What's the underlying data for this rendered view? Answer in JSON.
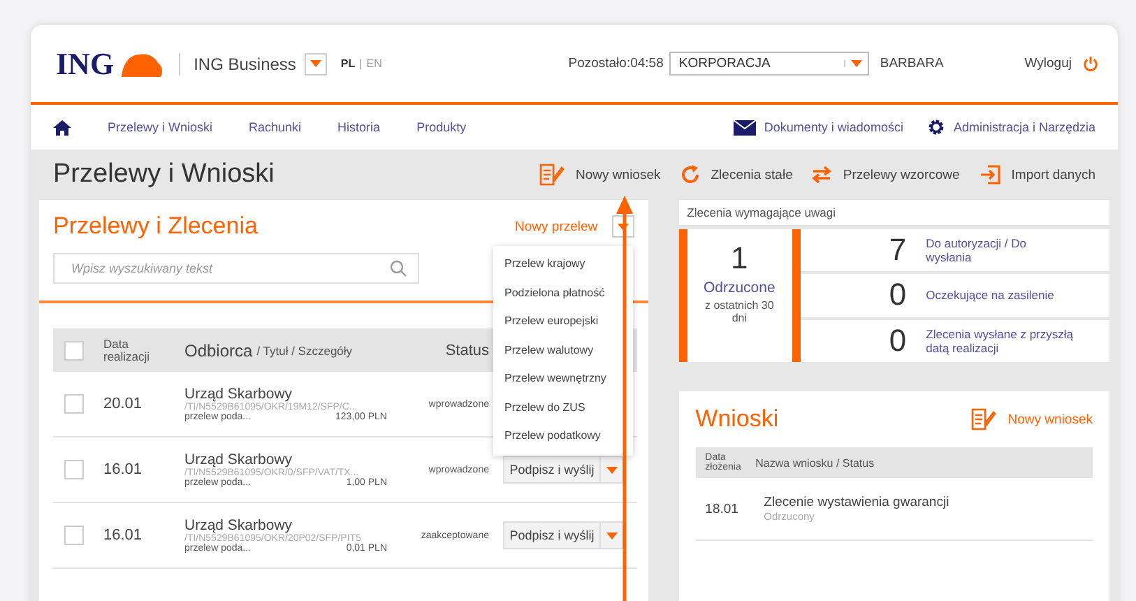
{
  "header": {
    "logo": "ING",
    "product": "ING Business",
    "languages": [
      {
        "label": "PL",
        "selected": true
      },
      {
        "label": "EN",
        "selected": false
      }
    ],
    "language_separator": "|",
    "session": "Pozostało:04:58",
    "company": "KORPORACJA",
    "user": "BARBARA",
    "logout": "Wyloguj"
  },
  "nav": {
    "items": [
      {
        "label": "Przelewy i Wnioski"
      },
      {
        "label": "Rachunki"
      },
      {
        "label": "Historia"
      },
      {
        "label": "Produkty"
      }
    ],
    "right": [
      {
        "label": "Dokumenty i wiadomości"
      },
      {
        "label": "Administracja i Narzędzia"
      }
    ]
  },
  "page": {
    "title": "Przelewy i Wnioski",
    "actions": [
      {
        "label": "Nowy wniosek"
      },
      {
        "label": "Zlecenia stałe"
      },
      {
        "label": "Przelewy wzorcowe"
      },
      {
        "label": "Import danych"
      }
    ]
  },
  "transfers": {
    "title": "Przelewy i Zlecenia",
    "new_button": "Nowy przelew",
    "search": {
      "placeholder": "Wpisz wyszukiwany tekst"
    },
    "all_checked": false,
    "columns": {
      "date": "Data realizacji",
      "recipient": "Odbiorca",
      "details": "/ Tytuł / Szczegóły",
      "status": "Status"
    },
    "rows": [
      {
        "checked": false,
        "date": "20.01",
        "recipient": "Urząd Skarbowy",
        "reference": "/TI/N5529B61095/OKR/19M12/SFP/C...",
        "title": "przelew poda...",
        "amount": "123,00 PLN",
        "status": "wprowadzone"
      },
      {
        "checked": false,
        "date": "16.01",
        "recipient": "Urząd Skarbowy",
        "reference": "/TI/N5529B61095/OKR/0/SFP/VAT/TX...",
        "title": "przelew poda...",
        "amount": "1,00 PLN",
        "status": "wprowadzone",
        "action": "Podpisz i wyślij"
      },
      {
        "checked": false,
        "date": "16.01",
        "recipient": "Urząd Skarbowy",
        "reference": "/TI/N5529B61095/OKR/20P02/SFP/PIT5",
        "title": "przelew poda...",
        "amount": "0,01 PLN",
        "status": "zaakceptowane",
        "action": "Podpisz i wyślij"
      }
    ],
    "menu": [
      "Przelew krajowy",
      "Podzielona płatność",
      "Przelew europejski",
      "Przelew walutowy",
      "Przelew wewnętrzny",
      "Przelew do ZUS",
      "Przelew podatkowy"
    ]
  },
  "attention": {
    "title": "Zlecenia wymagające uwagi",
    "rejected": {
      "count": "1",
      "label": "Odrzucone",
      "note": "z ostatnich 30 dni"
    },
    "items": [
      {
        "count": "7",
        "label": "Do autoryzacji / Do wysłania"
      },
      {
        "count": "0",
        "label": "Oczekujące na zasilenie"
      },
      {
        "count": "0",
        "label": "Zlecenia wysłane z przyszłą datą realizacji"
      }
    ]
  },
  "applications": {
    "title": "Wnioski",
    "new_button": "Nowy wniosek",
    "columns": {
      "date": "Data złożenia",
      "name": "Nazwa wniosku / Status"
    },
    "rows": [
      {
        "date": "18.01",
        "name": "Zlecenie wystawienia gwarancji",
        "status": "Odrzucony"
      }
    ]
  }
}
